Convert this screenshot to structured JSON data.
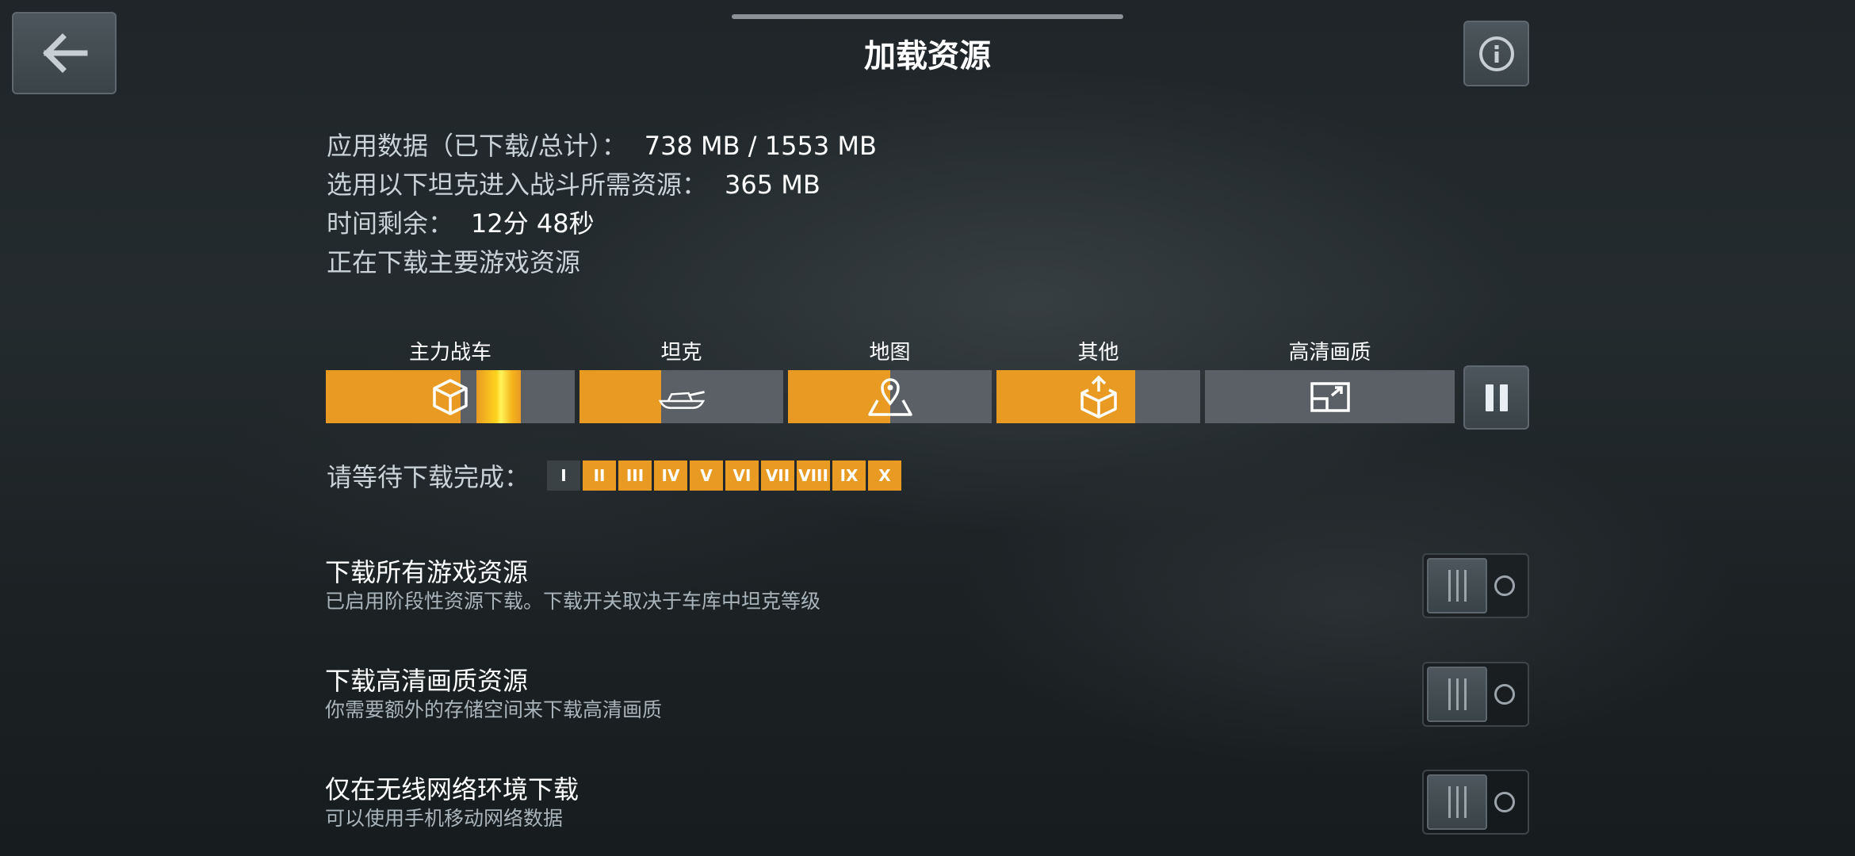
{
  "header": {
    "title": "加载资源"
  },
  "stats": {
    "app_data_label": "应用数据（已下载/总计）：",
    "app_data_value": "738 MB / 1553 MB",
    "selected_label": "选用以下坦克进入战斗所需资源：",
    "selected_value": "365 MB",
    "time_label": "时间剩余：",
    "time_value": "12分 48秒",
    "status": "正在下载主要游戏资源"
  },
  "categories": [
    {
      "label": "主力战车",
      "icon": "cube-icon",
      "progress": 0.54
    },
    {
      "label": "坦克",
      "icon": "tank-icon",
      "progress": 0.4
    },
    {
      "label": "地图",
      "icon": "map-pin-icon",
      "progress": 0.5
    },
    {
      "label": "其他",
      "icon": "box-upload-icon",
      "progress": 0.68
    },
    {
      "label": "高清画质",
      "icon": "hd-expand-icon",
      "progress": 0.0
    }
  ],
  "wait": {
    "label": "请等待下载完成：",
    "tiers": [
      "I",
      "II",
      "III",
      "IV",
      "V",
      "VI",
      "VII",
      "VIII",
      "IX",
      "X"
    ],
    "completed_tiers": [
      "I"
    ]
  },
  "settings": [
    {
      "title": "下载所有游戏资源",
      "desc": "已启用阶段性资源下载。下载开关取决于车库中坦克等级",
      "enabled": false
    },
    {
      "title": "下载高清画质资源",
      "desc": "你需要额外的存储空间来下载高清画质",
      "enabled": false
    },
    {
      "title": "仅在无线网络环境下载",
      "desc": "可以使用手机移动网络数据",
      "enabled": false
    }
  ],
  "colors": {
    "accent": "#e89a22",
    "track": "#5a6065",
    "glow": "#fff45a"
  }
}
